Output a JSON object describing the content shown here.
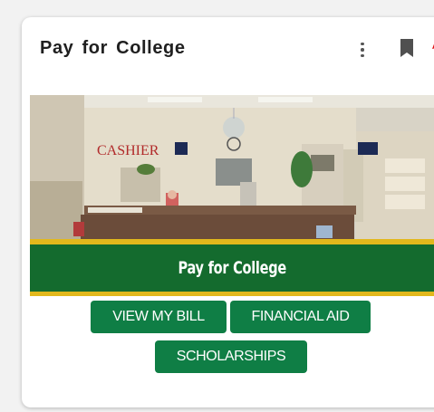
{
  "card": {
    "title": "Pay for College",
    "menu_icon": "more-vert-icon",
    "bookmark_icon": "bookmark-icon",
    "annotation_icon": "red-arrow-icon"
  },
  "banner": {
    "sign_text": "CASHIER",
    "caption": "Pay for College",
    "colors": {
      "green": "#146b2e",
      "gold": "#e2b81c"
    }
  },
  "buttons": {
    "view_bill": "VIEW MY BILL",
    "financial_aid": "FINANCIAL AID",
    "scholarships": "SCHOLARSHIPS",
    "color": "#0f7e45"
  }
}
